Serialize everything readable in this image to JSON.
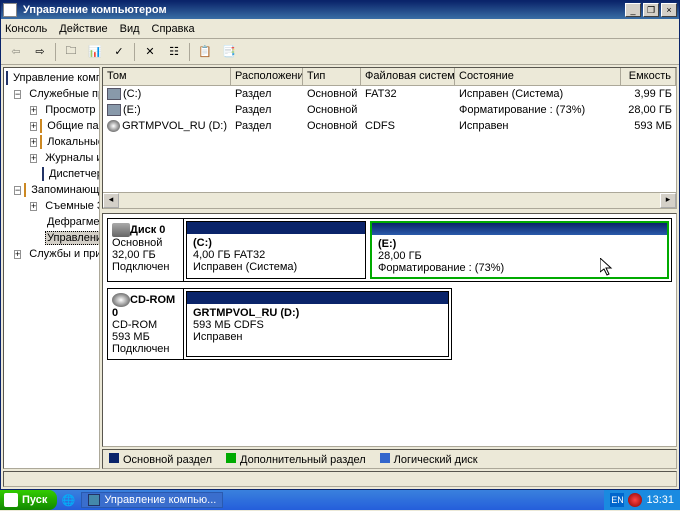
{
  "title": "Управление компьютером",
  "menu": {
    "console": "Консоль",
    "action": "Действие",
    "view": "Вид",
    "help": "Справка"
  },
  "tree": {
    "root": "Управление компьютером (локал",
    "n1": "Служебные программы",
    "n1a": "Просмотр событий",
    "n1b": "Общие папки",
    "n1c": "Локальные пользователи",
    "n1d": "Журналы и оповещения",
    "n1e": "Диспетчер устройств",
    "n2": "Запоминающие устройства",
    "n2a": "Съемные ЗУ",
    "n2b": "Дефрагментация диска",
    "n2c": "Управление дисками",
    "n3": "Службы и приложения"
  },
  "cols": {
    "c0": "Том",
    "c1": "Расположение",
    "c2": "Тип",
    "c3": "Файловая система",
    "c4": "Состояние",
    "c5": "Емкость"
  },
  "rows": [
    {
      "name": "(C:)",
      "layout": "Раздел",
      "type": "Основной",
      "fs": "FAT32",
      "state": "Исправен (Система)",
      "cap": "3,99 ГБ",
      "ic": "ic-part"
    },
    {
      "name": "(E:)",
      "layout": "Раздел",
      "type": "Основной",
      "fs": "",
      "state": "Форматирование : (73%)",
      "cap": "28,00 ГБ",
      "ic": "ic-part"
    },
    {
      "name": "GRTMPVOL_RU (D:)",
      "layout": "Раздел",
      "type": "Основной",
      "fs": "CDFS",
      "state": "Исправен",
      "cap": "593 МБ",
      "ic": "ic-cd"
    }
  ],
  "disk0": {
    "name": "Диск 0",
    "type": "Основной",
    "size": "32,00 ГБ",
    "state": "Подключен"
  },
  "cdrom": {
    "name": "CD-ROM 0",
    "type": "CD-ROM",
    "size": "593 МБ",
    "state": "Подключен"
  },
  "partC": {
    "name": "(C:)",
    "info": "4,00 ГБ FAT32",
    "state": "Исправен (Система)"
  },
  "partE": {
    "name": "(E:)",
    "info": "28,00 ГБ",
    "state": "Форматирование : (73%)"
  },
  "partD": {
    "name": "GRTMPVOL_RU (D:)",
    "info": "593 МБ CDFS",
    "state": "Исправен"
  },
  "legend": {
    "l1": "Основной раздел",
    "l2": "Дополнительный раздел",
    "l3": "Логический диск"
  },
  "start": "Пуск",
  "task": "Управление компью...",
  "clock": "13:31",
  "lang": "EN"
}
